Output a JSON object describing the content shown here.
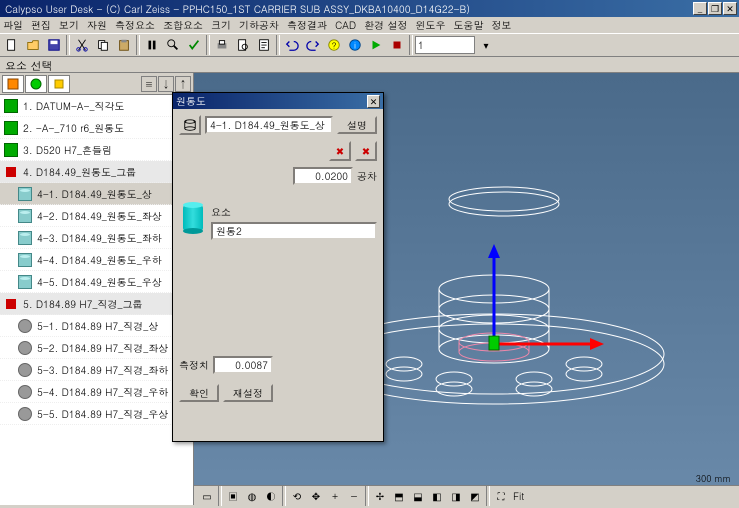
{
  "title": "Calypso User Desk - (C) Carl Zeiss - PPHC150_1ST CARRIER SUB ASSY_DKBA10400_D14G22-B)",
  "menu": {
    "file": "파일",
    "edit": "편집",
    "view": "보기",
    "resource": "자원",
    "measure": "측정요소",
    "assemble": "조합요소",
    "size": "크기",
    "tool": "기하공차",
    "result": "측정결과",
    "cad": "CAD",
    "env": "환경 설정",
    "window": "윈도우",
    "help": "도움말",
    "info": "정보"
  },
  "toolbar_input": "1",
  "panel_title": "요소 선택",
  "tree": [
    {
      "icon": "green",
      "label": "1. DATUM-A-_직각도",
      "indent": 0
    },
    {
      "icon": "green",
      "label": "2. -A-_710 r6_원통도",
      "indent": 0
    },
    {
      "icon": "green",
      "label": "3. D520 H7_흔들림",
      "indent": 0
    },
    {
      "icon": "red",
      "label": "4. D184.49_원통도_그룹",
      "indent": 0,
      "group": true
    },
    {
      "icon": "cyl",
      "label": "4-1. D184.49_원통도_상",
      "indent": 1,
      "selected": true
    },
    {
      "icon": "cyl",
      "label": "4-2. D184.49_원통도_좌상",
      "indent": 1
    },
    {
      "icon": "cyl",
      "label": "4-3. D184.49_원통도_좌하",
      "indent": 1
    },
    {
      "icon": "cyl",
      "label": "4-4. D184.49_원통도_우하",
      "indent": 1
    },
    {
      "icon": "cyl",
      "label": "4-5. D184.49_원통도_우상",
      "indent": 1
    },
    {
      "icon": "red",
      "label": "5. D184.89 H7_직경_그룹",
      "indent": 0,
      "group": true
    },
    {
      "icon": "gray",
      "label": "5-1. D184.89 H7_직경_상",
      "indent": 1
    },
    {
      "icon": "gray",
      "label": "5-2. D184.89 H7_직경_좌상",
      "indent": 1
    },
    {
      "icon": "gray",
      "label": "5-3. D184.89 H7_직경_좌하",
      "indent": 1
    },
    {
      "icon": "gray",
      "label": "5-4. D184.89 H7_직경_우하",
      "indent": 1
    },
    {
      "icon": "gray",
      "label": "5-5. D184.89 H7_직경_우상",
      "indent": 1
    }
  ],
  "dialog": {
    "title": "원통도",
    "name_field": "4-1. D184.49_원통도_상",
    "desc_btn": "설명",
    "tolerance": "0.0200",
    "tol_label": "공차",
    "element_label": "요소",
    "element_value": "원통2",
    "measured_label": "측정치",
    "measured_value": "0.0087",
    "ok": "확인",
    "reset": "재설정"
  },
  "scale": "300 mm",
  "fit_label": "Fit"
}
